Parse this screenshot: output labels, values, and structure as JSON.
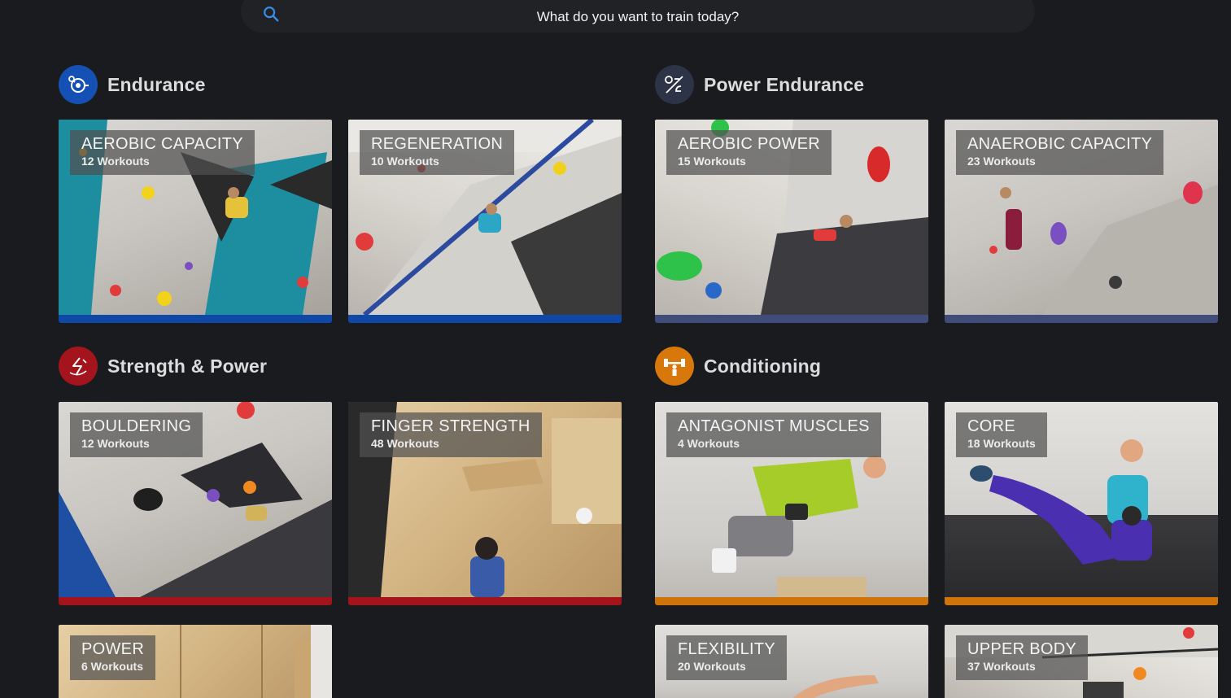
{
  "search": {
    "placeholder": "What do you want to train today?"
  },
  "colors": {
    "endurance": "#1248a0",
    "power_endurance": "#3c4a78",
    "strength_power": "#a0141c",
    "conditioning": "#d8780a"
  },
  "sections": {
    "endurance": {
      "title": "Endurance",
      "icon": "endurance-icon",
      "cards": [
        {
          "name": "AEROBIC CAPACITY",
          "count": "12 Workouts"
        },
        {
          "name": "REGENERATION",
          "count": "10 Workouts"
        }
      ]
    },
    "power_endurance": {
      "title": "Power Endurance",
      "icon": "power-endurance-icon",
      "cards": [
        {
          "name": "AEROBIC POWER",
          "count": "15 Workouts"
        },
        {
          "name": "ANAEROBIC CAPACITY",
          "count": "23 Workouts"
        }
      ]
    },
    "strength_power": {
      "title": "Strength & Power",
      "icon": "strength-icon",
      "cards": [
        {
          "name": "BOULDERING",
          "count": "12 Workouts"
        },
        {
          "name": "FINGER STRENGTH",
          "count": "48 Workouts"
        },
        {
          "name": "POWER",
          "count": "6 Workouts"
        }
      ]
    },
    "conditioning": {
      "title": "Conditioning",
      "icon": "dumbbell-icon",
      "cards": [
        {
          "name": "ANTAGONIST MUSCLES",
          "count": "4 Workouts"
        },
        {
          "name": "CORE",
          "count": "18 Workouts"
        },
        {
          "name": "FLEXIBILITY",
          "count": "20 Workouts"
        },
        {
          "name": "UPPER BODY",
          "count": "37 Workouts"
        }
      ]
    }
  }
}
